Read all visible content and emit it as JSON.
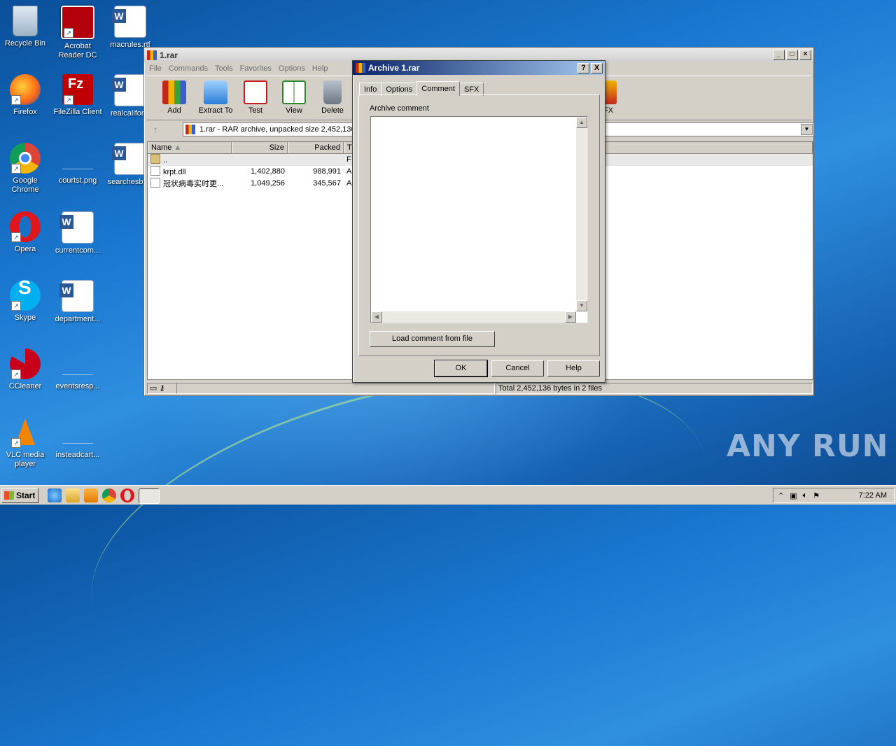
{
  "desktop": {
    "icons": [
      {
        "label": "Recycle Bin",
        "icon": "recycle-bin-icon"
      },
      {
        "label": "Acrobat Reader DC",
        "icon": "acrobat-icon"
      },
      {
        "label": "macrules.rtf",
        "icon": "word-doc-icon"
      },
      {
        "label": "Firefox",
        "icon": "firefox-icon"
      },
      {
        "label": "FileZilla Client",
        "icon": "filezilla-icon"
      },
      {
        "label": "realcalifor...",
        "icon": "word-doc-icon"
      },
      {
        "label": "Google Chrome",
        "icon": "chrome-icon"
      },
      {
        "label": "courtst.png",
        "icon": "image-file-icon"
      },
      {
        "label": "searchesby...",
        "icon": "word-doc-icon"
      },
      {
        "label": "Opera",
        "icon": "opera-icon"
      },
      {
        "label": "currentcom...",
        "icon": "word-doc-icon"
      },
      {
        "label": "Skype",
        "icon": "skype-icon"
      },
      {
        "label": "department...",
        "icon": "word-doc-icon"
      },
      {
        "label": "CCleaner",
        "icon": "ccleaner-icon"
      },
      {
        "label": "eventsresp...",
        "icon": "file-icon"
      },
      {
        "label": "VLC media player",
        "icon": "vlc-icon"
      },
      {
        "label": "insteadcart...",
        "icon": "file-icon"
      }
    ],
    "watermark": "ANY RUN"
  },
  "winrar": {
    "title": "1.rar",
    "menu": [
      "File",
      "Commands",
      "Tools",
      "Favorites",
      "Options",
      "Help"
    ],
    "toolbar": [
      {
        "label": "Add",
        "icon": "add-icon"
      },
      {
        "label": "Extract To",
        "icon": "extract-icon"
      },
      {
        "label": "Test",
        "icon": "test-icon"
      },
      {
        "label": "View",
        "icon": "view-icon"
      },
      {
        "label": "Delete",
        "icon": "delete-icon"
      },
      {
        "label": "FX",
        "icon": "sfx-icon"
      }
    ],
    "address": "1.rar - RAR archive, unpacked size 2,452,136",
    "columns": [
      "Name",
      "Size",
      "Packed",
      "T"
    ],
    "rows": [
      {
        "name": "..",
        "size": "",
        "packed": "",
        "type": "F"
      },
      {
        "name": "krpt.dll",
        "size": "1,402,880",
        "packed": "988,991",
        "type": "A"
      },
      {
        "name": "冠状病毒实时更...",
        "size": "1,049,256",
        "packed": "345,567",
        "type": "A"
      }
    ],
    "status": "Total 2,452,136 bytes in 2 files"
  },
  "dialog": {
    "title": "Archive 1.rar",
    "help_btn": "?",
    "close_btn": "X",
    "tabs": [
      "Info",
      "Options",
      "Comment",
      "SFX"
    ],
    "active_tab": "Comment",
    "comment_label": "Archive comment",
    "comment_value": "",
    "load_button": "Load comment from file",
    "ok": "OK",
    "cancel": "Cancel",
    "help": "Help"
  },
  "taskbar": {
    "start": "Start",
    "clock": "7:22 AM"
  }
}
